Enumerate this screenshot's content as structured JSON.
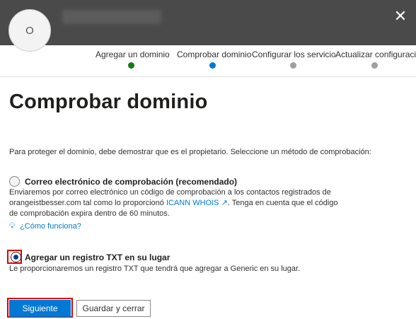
{
  "header": {
    "avatar_initial": "O",
    "close_glyph": "✕"
  },
  "steps": [
    {
      "label": "Agregar un dominio",
      "status": "done"
    },
    {
      "label": "Comprobar dominio",
      "status": "current"
    },
    {
      "label": "Configurar los servicio",
      "status": "todo"
    },
    {
      "label": "Actualizar configuraci",
      "status": "todo"
    }
  ],
  "page": {
    "title": "Comprobar dominio",
    "intro": "Para proteger el dominio, debe demostrar que es el propietario. Seleccione un método de comprobación:"
  },
  "options": {
    "email": {
      "title": "Correo electrónico de comprobación (recomendado)",
      "desc_part1": "Enviaremos por correo electrónico un código de comprobación a los contactos registrados de orangeistbesser.com tal como lo proporcionó ",
      "link": "ICANN WHOIS",
      "desc_part2": ". Tenga en cuenta que el código de comprobación expira dentro de 60 minutos.",
      "selected": false
    },
    "txt": {
      "title": "Agregar un registro TXT en su lugar",
      "desc": "Le proporcionaremos un registro TXT que tendrá que agregar a Generic en su lugar.",
      "selected": true
    }
  },
  "help": {
    "label": "¿Cómo funciona?",
    "icon": "lightbulb-icon"
  },
  "buttons": {
    "next": "Siguiente",
    "save_close": "Guardar y cerrar"
  },
  "colors": {
    "header_bg": "#4a4a4a",
    "accent": "#0078d4",
    "done": "#107c10",
    "highlight": "#e00000"
  }
}
